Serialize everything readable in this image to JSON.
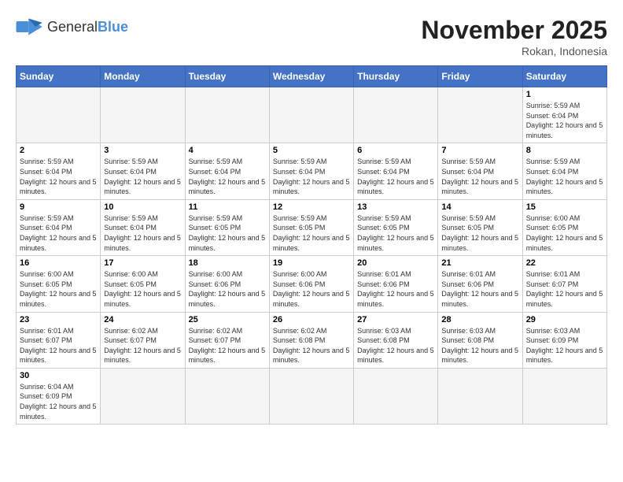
{
  "header": {
    "logo_general": "General",
    "logo_blue": "Blue",
    "month_title": "November 2025",
    "location": "Rokan, Indonesia"
  },
  "weekdays": [
    "Sunday",
    "Monday",
    "Tuesday",
    "Wednesday",
    "Thursday",
    "Friday",
    "Saturday"
  ],
  "weeks": [
    [
      {
        "day": "",
        "empty": true
      },
      {
        "day": "",
        "empty": true
      },
      {
        "day": "",
        "empty": true
      },
      {
        "day": "",
        "empty": true
      },
      {
        "day": "",
        "empty": true
      },
      {
        "day": "",
        "empty": true
      },
      {
        "day": "1",
        "sunrise": "Sunrise: 5:59 AM",
        "sunset": "Sunset: 6:04 PM",
        "daylight": "Daylight: 12 hours and 5 minutes."
      }
    ],
    [
      {
        "day": "2",
        "sunrise": "Sunrise: 5:59 AM",
        "sunset": "Sunset: 6:04 PM",
        "daylight": "Daylight: 12 hours and 5 minutes."
      },
      {
        "day": "3",
        "sunrise": "Sunrise: 5:59 AM",
        "sunset": "Sunset: 6:04 PM",
        "daylight": "Daylight: 12 hours and 5 minutes."
      },
      {
        "day": "4",
        "sunrise": "Sunrise: 5:59 AM",
        "sunset": "Sunset: 6:04 PM",
        "daylight": "Daylight: 12 hours and 5 minutes."
      },
      {
        "day": "5",
        "sunrise": "Sunrise: 5:59 AM",
        "sunset": "Sunset: 6:04 PM",
        "daylight": "Daylight: 12 hours and 5 minutes."
      },
      {
        "day": "6",
        "sunrise": "Sunrise: 5:59 AM",
        "sunset": "Sunset: 6:04 PM",
        "daylight": "Daylight: 12 hours and 5 minutes."
      },
      {
        "day": "7",
        "sunrise": "Sunrise: 5:59 AM",
        "sunset": "Sunset: 6:04 PM",
        "daylight": "Daylight: 12 hours and 5 minutes."
      },
      {
        "day": "8",
        "sunrise": "Sunrise: 5:59 AM",
        "sunset": "Sunset: 6:04 PM",
        "daylight": "Daylight: 12 hours and 5 minutes."
      }
    ],
    [
      {
        "day": "9",
        "sunrise": "Sunrise: 5:59 AM",
        "sunset": "Sunset: 6:04 PM",
        "daylight": "Daylight: 12 hours and 5 minutes."
      },
      {
        "day": "10",
        "sunrise": "Sunrise: 5:59 AM",
        "sunset": "Sunset: 6:04 PM",
        "daylight": "Daylight: 12 hours and 5 minutes."
      },
      {
        "day": "11",
        "sunrise": "Sunrise: 5:59 AM",
        "sunset": "Sunset: 6:05 PM",
        "daylight": "Daylight: 12 hours and 5 minutes."
      },
      {
        "day": "12",
        "sunrise": "Sunrise: 5:59 AM",
        "sunset": "Sunset: 6:05 PM",
        "daylight": "Daylight: 12 hours and 5 minutes."
      },
      {
        "day": "13",
        "sunrise": "Sunrise: 5:59 AM",
        "sunset": "Sunset: 6:05 PM",
        "daylight": "Daylight: 12 hours and 5 minutes."
      },
      {
        "day": "14",
        "sunrise": "Sunrise: 5:59 AM",
        "sunset": "Sunset: 6:05 PM",
        "daylight": "Daylight: 12 hours and 5 minutes."
      },
      {
        "day": "15",
        "sunrise": "Sunrise: 6:00 AM",
        "sunset": "Sunset: 6:05 PM",
        "daylight": "Daylight: 12 hours and 5 minutes."
      }
    ],
    [
      {
        "day": "16",
        "sunrise": "Sunrise: 6:00 AM",
        "sunset": "Sunset: 6:05 PM",
        "daylight": "Daylight: 12 hours and 5 minutes."
      },
      {
        "day": "17",
        "sunrise": "Sunrise: 6:00 AM",
        "sunset": "Sunset: 6:05 PM",
        "daylight": "Daylight: 12 hours and 5 minutes."
      },
      {
        "day": "18",
        "sunrise": "Sunrise: 6:00 AM",
        "sunset": "Sunset: 6:06 PM",
        "daylight": "Daylight: 12 hours and 5 minutes."
      },
      {
        "day": "19",
        "sunrise": "Sunrise: 6:00 AM",
        "sunset": "Sunset: 6:06 PM",
        "daylight": "Daylight: 12 hours and 5 minutes."
      },
      {
        "day": "20",
        "sunrise": "Sunrise: 6:01 AM",
        "sunset": "Sunset: 6:06 PM",
        "daylight": "Daylight: 12 hours and 5 minutes."
      },
      {
        "day": "21",
        "sunrise": "Sunrise: 6:01 AM",
        "sunset": "Sunset: 6:06 PM",
        "daylight": "Daylight: 12 hours and 5 minutes."
      },
      {
        "day": "22",
        "sunrise": "Sunrise: 6:01 AM",
        "sunset": "Sunset: 6:07 PM",
        "daylight": "Daylight: 12 hours and 5 minutes."
      }
    ],
    [
      {
        "day": "23",
        "sunrise": "Sunrise: 6:01 AM",
        "sunset": "Sunset: 6:07 PM",
        "daylight": "Daylight: 12 hours and 5 minutes."
      },
      {
        "day": "24",
        "sunrise": "Sunrise: 6:02 AM",
        "sunset": "Sunset: 6:07 PM",
        "daylight": "Daylight: 12 hours and 5 minutes."
      },
      {
        "day": "25",
        "sunrise": "Sunrise: 6:02 AM",
        "sunset": "Sunset: 6:07 PM",
        "daylight": "Daylight: 12 hours and 5 minutes."
      },
      {
        "day": "26",
        "sunrise": "Sunrise: 6:02 AM",
        "sunset": "Sunset: 6:08 PM",
        "daylight": "Daylight: 12 hours and 5 minutes."
      },
      {
        "day": "27",
        "sunrise": "Sunrise: 6:03 AM",
        "sunset": "Sunset: 6:08 PM",
        "daylight": "Daylight: 12 hours and 5 minutes."
      },
      {
        "day": "28",
        "sunrise": "Sunrise: 6:03 AM",
        "sunset": "Sunset: 6:08 PM",
        "daylight": "Daylight: 12 hours and 5 minutes."
      },
      {
        "day": "29",
        "sunrise": "Sunrise: 6:03 AM",
        "sunset": "Sunset: 6:09 PM",
        "daylight": "Daylight: 12 hours and 5 minutes."
      }
    ],
    [
      {
        "day": "30",
        "sunrise": "Sunrise: 6:04 AM",
        "sunset": "Sunset: 6:09 PM",
        "daylight": "Daylight: 12 hours and 5 minutes."
      },
      {
        "day": "",
        "empty": true
      },
      {
        "day": "",
        "empty": true
      },
      {
        "day": "",
        "empty": true
      },
      {
        "day": "",
        "empty": true
      },
      {
        "day": "",
        "empty": true
      },
      {
        "day": "",
        "empty": true
      }
    ]
  ]
}
